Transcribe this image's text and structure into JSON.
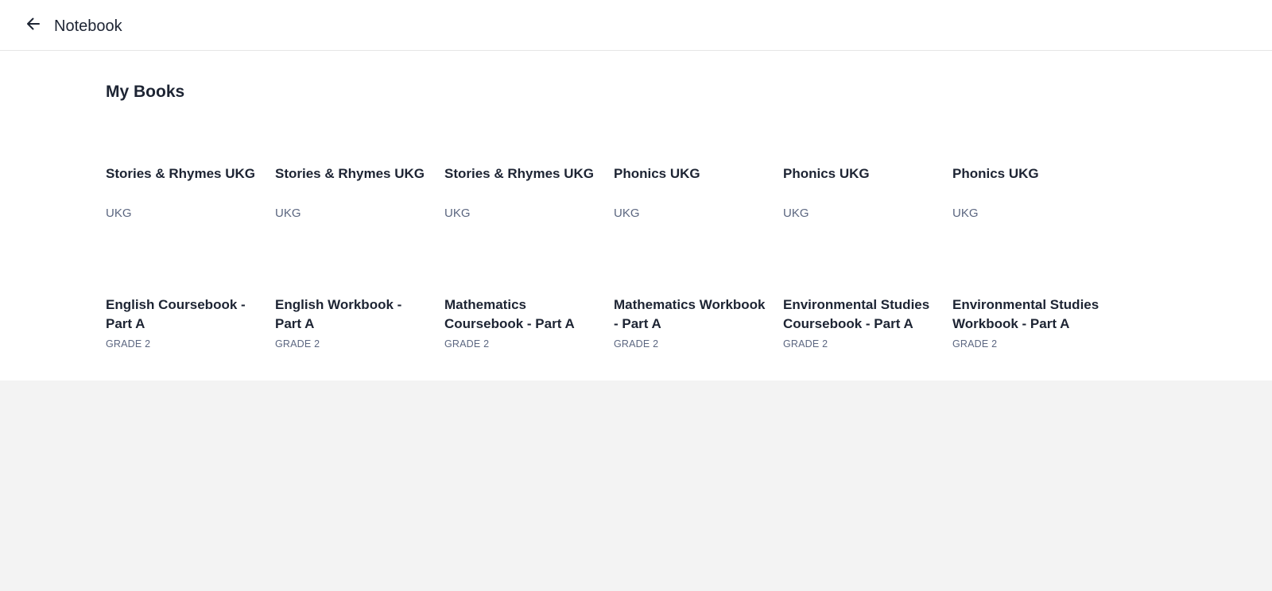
{
  "header": {
    "back_icon": "arrow-left-icon",
    "title": "Notebook"
  },
  "main": {
    "section_title": "My Books",
    "books_row_1": [
      {
        "title": "Stories & Rhymes UKG",
        "grade": "UKG"
      },
      {
        "title": "Stories & Rhymes UKG",
        "grade": "UKG"
      },
      {
        "title": "Stories & Rhymes UKG",
        "grade": "UKG"
      },
      {
        "title": "Phonics UKG",
        "grade": "UKG"
      },
      {
        "title": "Phonics UKG",
        "grade": "UKG"
      },
      {
        "title": "Phonics UKG",
        "grade": "UKG"
      }
    ],
    "books_row_2": [
      {
        "title": "English Coursebook - Part A",
        "grade": "GRADE 2"
      },
      {
        "title": "English Workbook - Part A",
        "grade": "GRADE 2"
      },
      {
        "title": "Mathematics Coursebook - Part A",
        "grade": "GRADE 2"
      },
      {
        "title": "Mathematics Workbook - Part A",
        "grade": "GRADE 2"
      },
      {
        "title": "Environmental Studies Coursebook - Part A",
        "grade": "GRADE 2"
      },
      {
        "title": "Environmental Studies Workbook - Part A",
        "grade": "GRADE 2"
      }
    ]
  },
  "colors": {
    "text_primary": "#1d2433",
    "text_secondary": "#5b6680",
    "page_background": "#f3f3f3",
    "surface": "#ffffff"
  }
}
